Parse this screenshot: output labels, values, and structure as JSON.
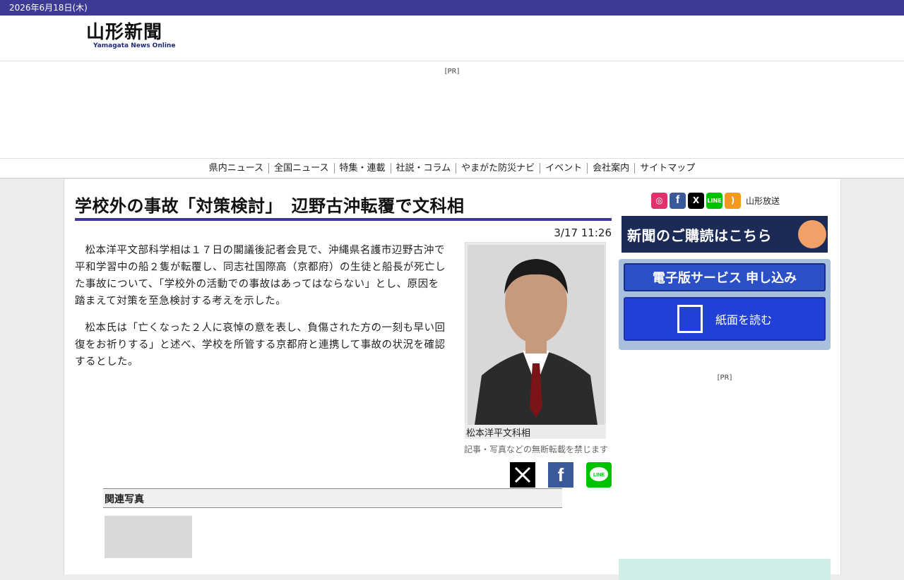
{
  "date": "2026年6月18日(木)",
  "logo": {
    "main": "山形新聞",
    "sub": "Yamagata News Online"
  },
  "ad_label": "[PR]",
  "nav": [
    "県内ニュース",
    "全国ニュース",
    "特集・連載",
    "社説・コラム",
    "やまがた防災ナビ",
    "イベント",
    "会社案内",
    "サイトマップ"
  ],
  "article": {
    "title": "学校外の事故「対策検討」　辺野古沖転覆で文科相",
    "time": "3/17 11:26",
    "paragraphs": [
      "松本洋平文部科学相は１７日の閣議後記者会見で、沖縄県名護市辺野古沖で平和学習中の船２隻が転覆し、同志社国際高（京都府）の生徒と船長が死亡した事故について、「学校外の活動での事故はあってはならない」とし、原因を踏まえて対策を至急検討する考えを示した。",
      "松本氏は「亡くなった２人に哀悼の意を表し、負傷された方の一刻も早い回復をお祈りする」と述べ、学校を所管する京都府と連携して事故の状況を確認するとした。"
    ],
    "photo_caption": "松本洋平文科相",
    "copyright": "記事・写真などの無断転載を禁じます",
    "share_icons": [
      "x-icon",
      "facebook-icon",
      "line-icon"
    ]
  },
  "related": {
    "heading": "関連写真"
  },
  "sidebar": {
    "social_icons": [
      "instagram-icon",
      "facebook-icon",
      "x-icon",
      "line-icon",
      "rss-icon"
    ],
    "ybc_label": "山形放送",
    "subscribe": "新聞のご購読はこちら",
    "digital_service": "電子版サービス 申し込み",
    "read_paper": "紙面を読む",
    "ad_label": "[PR]"
  },
  "colors": {
    "brand": "#3d3a96",
    "digital": "#2b4fc4",
    "subscribe": "#1c2a58"
  }
}
